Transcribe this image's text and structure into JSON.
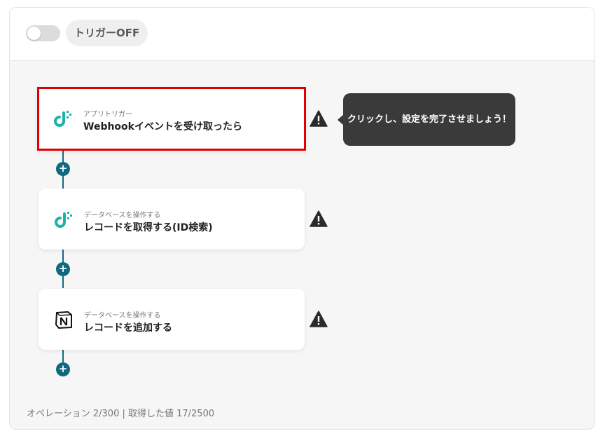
{
  "trigger": {
    "state": "off",
    "label": "トリガーOFF"
  },
  "steps": [
    {
      "subtitle": "アプリトリガー",
      "title": "Webhookイベントを受け取ったら",
      "app_icon": "yoom-icon",
      "warning": true,
      "selected": true
    },
    {
      "subtitle": "データベースを操作する",
      "title": "レコードを取得する(ID検索)",
      "app_icon": "yoom-icon",
      "warning": true,
      "selected": false
    },
    {
      "subtitle": "データベースを操作する",
      "title": "レコードを追加する",
      "app_icon": "notion-icon",
      "warning": true,
      "selected": false
    }
  ],
  "tooltip": {
    "text": "クリックし、設定を完了させましょう！"
  },
  "footer": {
    "text": "オペレーション 2/300 | 取得した値 17/2500"
  },
  "colors": {
    "accent": "#0e6b7f",
    "selection_border": "#e00000",
    "tooltip_bg": "#3a3a3a",
    "yoom_teal": "#1bb3a6"
  }
}
